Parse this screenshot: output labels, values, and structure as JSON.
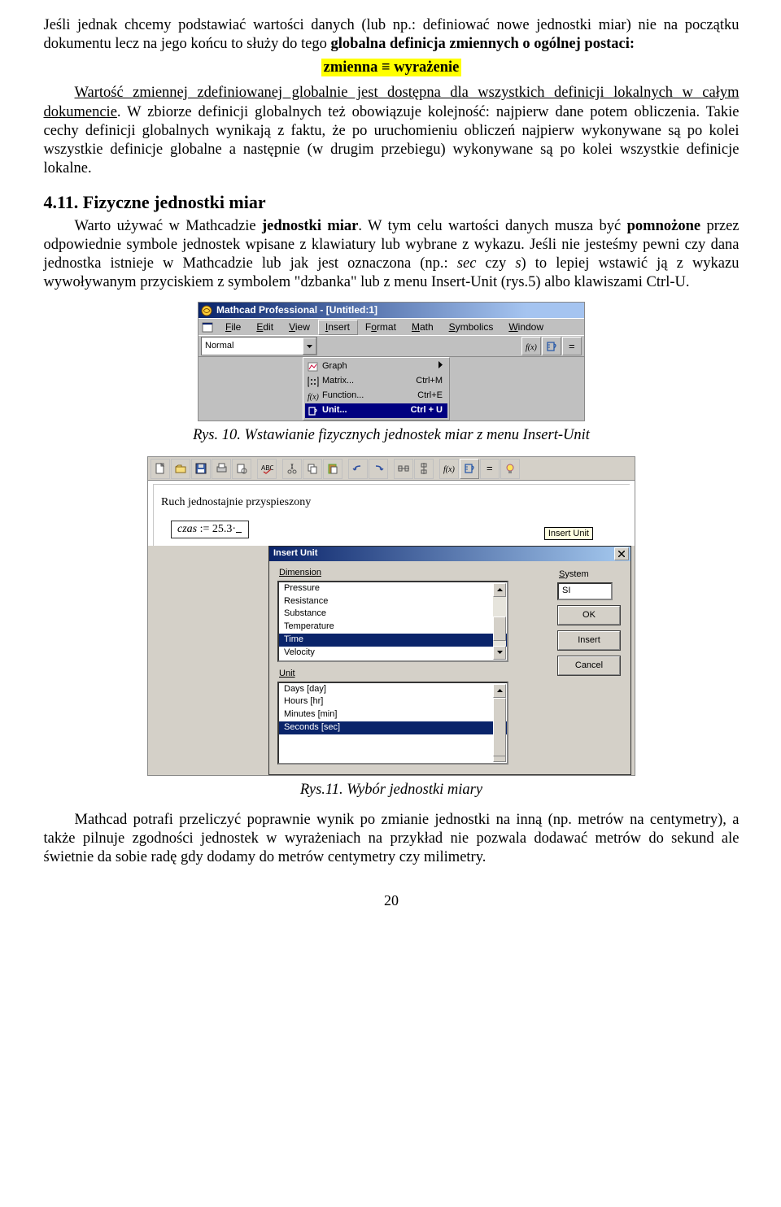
{
  "p1": "Jeśli jednak chcemy podstawiać wartości danych (lub np.: definiować nowe jednostki miar) nie na początku dokumentu lecz na jego końcu to służy do tego ",
  "p1b": "globalna definicja zmiennych o ogólnej postaci:",
  "formula": "zmienna ≡ wyrażenie",
  "p2a": "Wartość zmiennej zdefiniowanej globalnie jest dostępna dla wszystkich definicji ",
  "p2b": "lokalnych w całym dokumencie",
  "p2c": ". W zbiorze definicji globalnych też obowiązuje kolejność: najpierw dane potem obliczenia. Takie cechy definicji globalnych wynikają z faktu, że po uruchomieniu obliczeń najpierw wykonywane są po kolei wszystkie definicje globalne a następnie (w drugim przebiegu) wykonywane są po kolei wszystkie definicje lokalne.",
  "h_411": "4.11.  Fizyczne jednostki miar",
  "p3": "Warto używać w Mathcadzie ",
  "p3b": "jednostki miar",
  "p3c": ". W tym celu wartości danych musza być ",
  "p3d": "pomnożone",
  "p3e": " przez odpowiednie symbole jednostek wpisane z klawiatury lub wybrane z wykazu. Jeśli nie jesteśmy pewni czy dana jednostka istnieje w Mathcadzie lub jak jest oznaczona (np.: ",
  "p3f": "sec",
  "p3g": " czy ",
  "p3h": "s",
  "p3i": ") to lepiej wstawić ją z wykazu wywoływanym przyciskiem z symbolem \"dzbanka\" lub z menu Insert-Unit (rys.5) albo klawiszami Ctrl-U.",
  "fig10": {
    "title": "Mathcad Professional - [Untitled:1]",
    "menus": [
      "File",
      "Edit",
      "View",
      "Insert",
      "Format",
      "Math",
      "Symbolics",
      "Window"
    ],
    "combo": "Normal",
    "dropdown": [
      {
        "icon": "graph",
        "label": "Graph",
        "short": ""
      },
      {
        "icon": "matrix",
        "label": "Matrix...",
        "short": "Ctrl+M"
      },
      {
        "icon": "fx",
        "label": "Function...",
        "short": "Ctrl+E"
      },
      {
        "icon": "unit",
        "label": "Unit...",
        "short": "Ctrl + U"
      }
    ]
  },
  "caption10": "Rys. 10. Wstawianie fizycznych jednostek miar z menu Insert-Unit",
  "fig11": {
    "doc_text": "Ruch jednostajnie przyspieszony",
    "expr": "czas := 25.3·",
    "tooltip": "Insert Unit",
    "dialog_title": "Insert Unit",
    "dim_label": "Dimension",
    "sys_label": "System",
    "sys_value": "SI",
    "dim_items": [
      "Pressure",
      "Resistance",
      "Substance",
      "Temperature",
      "Time",
      "Velocity"
    ],
    "unit_label": "Unit",
    "unit_items": [
      "Days [day]",
      "Hours [hr]",
      "Minutes [min]",
      "Seconds [sec]"
    ],
    "btn_ok": "OK",
    "btn_insert": "Insert",
    "btn_cancel": "Cancel"
  },
  "caption11": "Rys.11. Wybór jednostki miary",
  "p4": "Mathcad potrafi przeliczyć poprawnie wynik po zmianie jednostki na inną (np. metrów na centymetry), a także pilnuje zgodności jednostek w wyrażeniach na przykład nie pozwala dodawać metrów do sekund ale świetnie da sobie radę gdy dodamy do metrów centymetry czy milimetry.",
  "page_number": "20"
}
